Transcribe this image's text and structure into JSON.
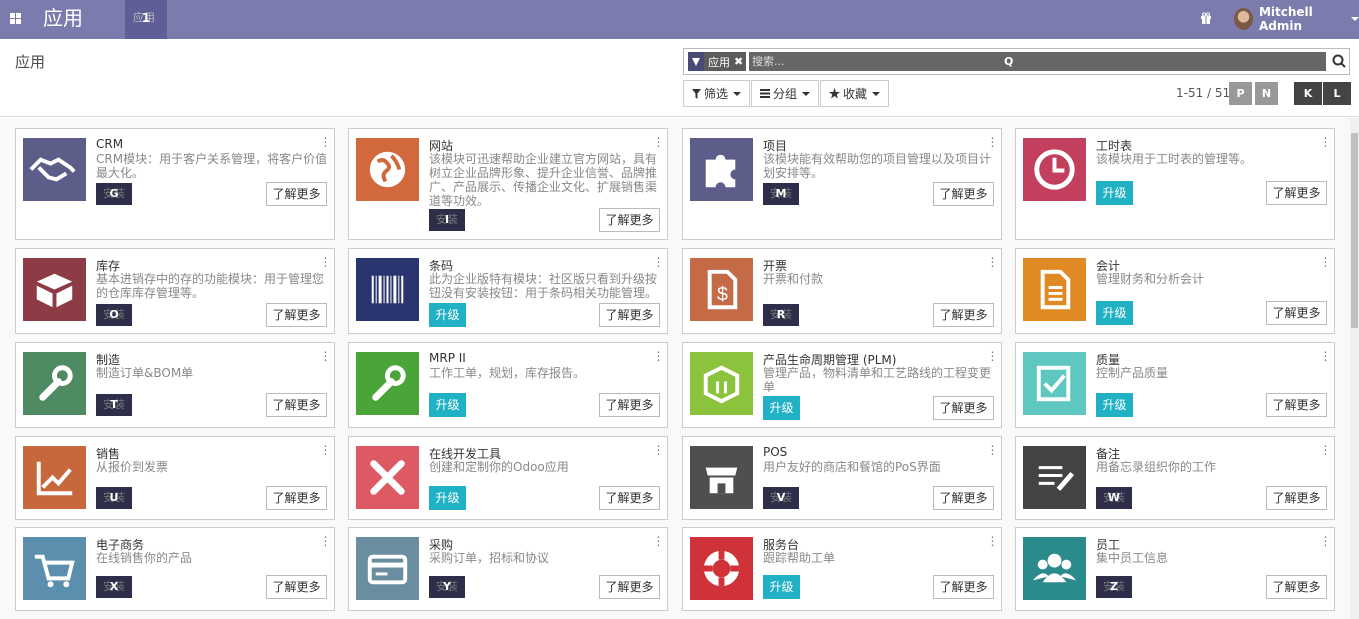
{
  "topbar": {
    "brand": "应用",
    "menu_ghost": "应用",
    "menu_key": "1",
    "user": "Mitchell Admin",
    "color": "#7c7bad"
  },
  "control": {
    "breadcrumb": "应用",
    "facet_label": "应用",
    "facet_remove": "✖",
    "search_placeholder": "搜索...",
    "search_key": "Q",
    "filters_label": "筛选",
    "group_label": "分组",
    "fav_label": "收藏",
    "pager": "1-51 / 51",
    "pager_prev": "P",
    "pager_next": "N",
    "view_kanban": "K",
    "view_list": "L"
  },
  "labels": {
    "learn": "了解更多",
    "upgrade": "升级",
    "install": "安装"
  },
  "colors": {
    "upgrade": "#21b1c4",
    "install": "#2e2e4a"
  },
  "apps": [
    {
      "title": "CRM",
      "desc": "CRM模块：用于客户关系管理，将客户价值最大化。",
      "action": "install",
      "key": "G",
      "icon": "handshake-icon",
      "color": "#5c5d88"
    },
    {
      "title": "网站",
      "desc": "该模块可迅速帮助企业建立官方网站，具有树立企业品牌形象、提升企业信誉、品牌推广、产品展示、传播企业文化、扩展销售渠道等功效。",
      "action": "install",
      "key": "I",
      "icon": "globe-icon",
      "color": "#d2693c"
    },
    {
      "title": "项目",
      "desc": "该模块能有效帮助您的项目管理以及项目计划安排等。",
      "action": "install",
      "key": "M",
      "icon": "puzzle-icon",
      "color": "#5c5d88"
    },
    {
      "title": "工时表",
      "desc": "该模块用于工时表的管理等。",
      "action": "upgrade",
      "key": "",
      "icon": "clock-icon",
      "color": "#c2405d"
    },
    {
      "title": "库存",
      "desc": "基本进销存中的存的功能模块：用于管理您的仓库库存管理等。",
      "action": "install",
      "key": "O",
      "icon": "box-icon",
      "color": "#8d3c45"
    },
    {
      "title": "条码",
      "desc": "此为企业版特有模块：社区版只看到升级按钮没有安装按钮：用于条码相关功能管理。",
      "action": "upgrade",
      "key": "",
      "icon": "barcode-icon",
      "color": "#2a3570"
    },
    {
      "title": "开票",
      "desc": "开票和付款",
      "action": "install",
      "key": "R",
      "icon": "invoice-icon",
      "color": "#c46a47"
    },
    {
      "title": "会计",
      "desc": "管理财务和分析会计",
      "action": "upgrade",
      "key": "",
      "icon": "document-icon",
      "color": "#e08a24"
    },
    {
      "title": "制造",
      "desc": "制造订单&BOM单",
      "action": "install",
      "key": "T",
      "icon": "wrench-icon",
      "color": "#4e8a62"
    },
    {
      "title": "MRP II",
      "desc": "工作工单，规划，库存报告。",
      "action": "upgrade",
      "key": "",
      "icon": "wrench-icon",
      "color": "#4aa538"
    },
    {
      "title": "产品生命周期管理 (PLM)",
      "desc": "管理产品，物料清单和工艺路线的工程变更单",
      "action": "upgrade",
      "key": "",
      "icon": "package-icon",
      "color": "#8cc33c"
    },
    {
      "title": "质量",
      "desc": "控制产品质量",
      "action": "upgrade",
      "key": "",
      "icon": "quality-icon",
      "color": "#5ec8c0"
    },
    {
      "title": "销售",
      "desc": "从报价到发票",
      "action": "install",
      "key": "U",
      "icon": "chart-icon",
      "color": "#c7683c"
    },
    {
      "title": "在线开发工具",
      "desc": "创建和定制你的Odoo应用",
      "action": "upgrade",
      "key": "",
      "icon": "tools-icon",
      "color": "#dd5a64"
    },
    {
      "title": "POS",
      "desc": "用户友好的商店和餐馆的PoS界面",
      "action": "install",
      "key": "V",
      "icon": "shop-icon",
      "color": "#4f4f4f"
    },
    {
      "title": "备注",
      "desc": "用备忘录组织你的工作",
      "action": "install",
      "key": "W",
      "icon": "note-icon",
      "color": "#444444"
    },
    {
      "title": "电子商务",
      "desc": "在线销售你的产品",
      "action": "install",
      "key": "X",
      "icon": "cart-icon",
      "color": "#5b8fad"
    },
    {
      "title": "采购",
      "desc": "采购订单，招标和协议",
      "action": "install",
      "key": "Y",
      "icon": "card-icon",
      "color": "#6a8da0"
    },
    {
      "title": "服务台",
      "desc": "跟踪帮助工单",
      "action": "upgrade",
      "key": "",
      "icon": "lifebuoy-icon",
      "color": "#d0323a"
    },
    {
      "title": "员工",
      "desc": "集中员工信息",
      "action": "install",
      "key": "Z",
      "icon": "users-icon",
      "color": "#2a8a8c"
    }
  ]
}
